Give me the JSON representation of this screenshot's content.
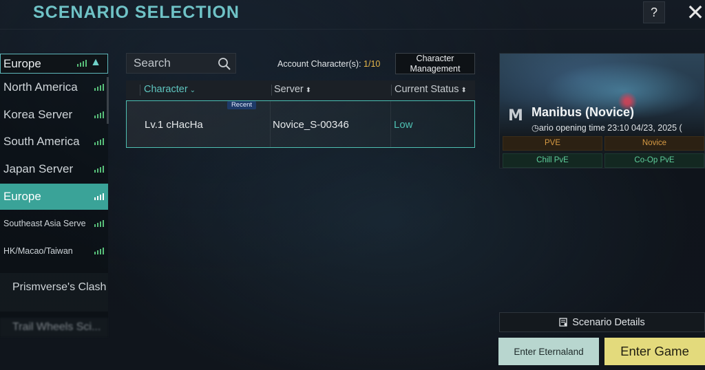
{
  "header": {
    "title": "SCENARIO SELECTION",
    "help_label": "?",
    "close_label": "✕"
  },
  "region_select": {
    "selected": "Europe",
    "chevron": "▲"
  },
  "regions": [
    {
      "label": "North America",
      "active": false
    },
    {
      "label": "Korea Server",
      "active": false
    },
    {
      "label": "South America",
      "active": false
    },
    {
      "label": "Japan Server",
      "active": false
    },
    {
      "label": "Europe",
      "active": true
    },
    {
      "label": "Southeast Asia Serve",
      "active": false
    },
    {
      "label": "HK/Macao/Taiwan",
      "active": false
    }
  ],
  "categories": {
    "prismverse": "Prismverse's Clash",
    "next": "Trail Wheels Sci..."
  },
  "search": {
    "placeholder": "Search",
    "icon": "search-icon"
  },
  "account": {
    "label": "Account Character(s): ",
    "count": "1/10",
    "manage_label": "Character Management"
  },
  "table": {
    "columns": {
      "character": "Character",
      "server": "Server",
      "status": "Current Status"
    },
    "sort_marker": "⌄",
    "sort_both": "⬍",
    "rows": [
      {
        "badge": "Recent",
        "character": "Lv.1 cHacHa",
        "server": "Novice_S-00346",
        "status": "Low"
      }
    ]
  },
  "scenario": {
    "title": "Manibus (Novice)",
    "time_text": "ario opening time 23:10 04/23, 2025 (",
    "logo": "M",
    "tags": [
      "PVE",
      "Novice",
      "Chill PvE",
      "Co-Op PvE"
    ]
  },
  "buttons": {
    "details": "Scenario Details",
    "eternaland": "Enter Eternaland",
    "game": "Enter Game"
  },
  "colors": {
    "accent": "#3aa398",
    "title": "#6fc2c6",
    "status_low": "#4fc1b3",
    "signal": "#58c07a",
    "enter_game": "#e3da7c",
    "enter_eternaland": "#b8d6cf"
  }
}
